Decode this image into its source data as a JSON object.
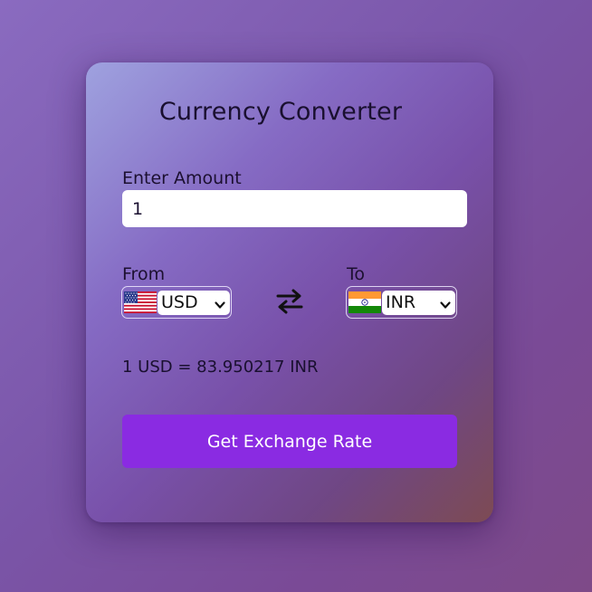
{
  "app": {
    "title": "Currency Converter"
  },
  "amount": {
    "label": "Enter Amount",
    "value": "1"
  },
  "from": {
    "label": "From",
    "currency": "USD",
    "flag_icon": "us-flag-icon"
  },
  "to": {
    "label": "To",
    "currency": "INR",
    "flag_icon": "india-flag-icon"
  },
  "swap": {
    "icon": "swap-arrows-icon"
  },
  "result": {
    "text": "1 USD = 83.950217 INR"
  },
  "action": {
    "button_label": "Get Exchange Rate"
  },
  "colors": {
    "button": "#8a2be2",
    "background": "#7a55a8"
  }
}
